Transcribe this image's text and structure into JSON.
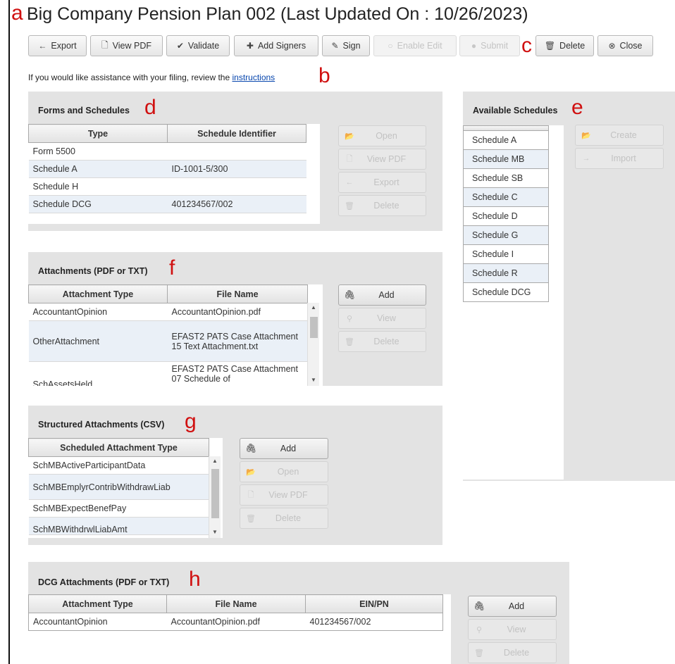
{
  "annotations": {
    "a": "a",
    "b": "b",
    "c": "c",
    "d": "d",
    "e": "e",
    "f": "f",
    "g": "g",
    "h": "h"
  },
  "page_title": "Big Company Pension Plan 002 (Last Updated On : 10/26/2023)",
  "toolbar": {
    "export": "Export",
    "view_pdf": "View PDF",
    "validate": "Validate",
    "add_signers": "Add Signers",
    "sign": "Sign",
    "enable_edit": "Enable Edit",
    "submit": "Submit",
    "delete": "Delete",
    "close": "Close"
  },
  "help": {
    "text": "If you would like assistance with your filing, review the",
    "link": "instructions"
  },
  "forms": {
    "title": "Forms and Schedules",
    "columns": [
      "Type",
      "Schedule Identifier"
    ],
    "rows": [
      [
        "Form 5500",
        ""
      ],
      [
        "Schedule A",
        "ID-1001-5/300"
      ],
      [
        "Schedule H",
        ""
      ],
      [
        "Schedule DCG",
        "401234567/002"
      ]
    ],
    "buttons": {
      "open": "Open",
      "view_pdf": "View PDF",
      "export": "Export",
      "delete": "Delete"
    }
  },
  "available": {
    "title": "Available Schedules",
    "items": [
      "Schedule A",
      "Schedule MB",
      "Schedule SB",
      "Schedule C",
      "Schedule D",
      "Schedule G",
      "Schedule I",
      "Schedule R",
      "Schedule DCG"
    ],
    "buttons": {
      "create": "Create",
      "import": "Import"
    }
  },
  "attachments": {
    "title": "Attachments (PDF or TXT)",
    "columns": [
      "Attachment Type",
      "File Name"
    ],
    "rows": [
      [
        "AccountantOpinion",
        "AccountantOpinion.pdf"
      ],
      [
        "OtherAttachment",
        "EFAST2 PATS Case Attachment 15 Text Attachment.txt"
      ],
      [
        "SchAssetsHeld",
        "EFAST2 PATS Case Attachment 07 Schedule of"
      ]
    ],
    "buttons": {
      "add": "Add",
      "view": "View",
      "delete": "Delete"
    }
  },
  "structured": {
    "title": "Structured Attachments (CSV)",
    "columns": [
      "Scheduled Attachment Type"
    ],
    "rows": [
      "SchMBActiveParticipantData",
      "SchMBEmplyrContribWithdrawLiab",
      "SchMBExpectBenefPay",
      "SchMBWithdrwlLiabAmt"
    ],
    "buttons": {
      "add": "Add",
      "open": "Open",
      "view_pdf": "View PDF",
      "delete": "Delete"
    }
  },
  "dcg": {
    "title": "DCG Attachments (PDF or TXT)",
    "columns": [
      "Attachment Type",
      "File Name",
      "EIN/PN"
    ],
    "rows": [
      [
        "AccountantOpinion",
        "AccountantOpinion.pdf",
        "401234567/002"
      ]
    ],
    "buttons": {
      "add": "Add",
      "view": "View",
      "delete": "Delete"
    }
  }
}
